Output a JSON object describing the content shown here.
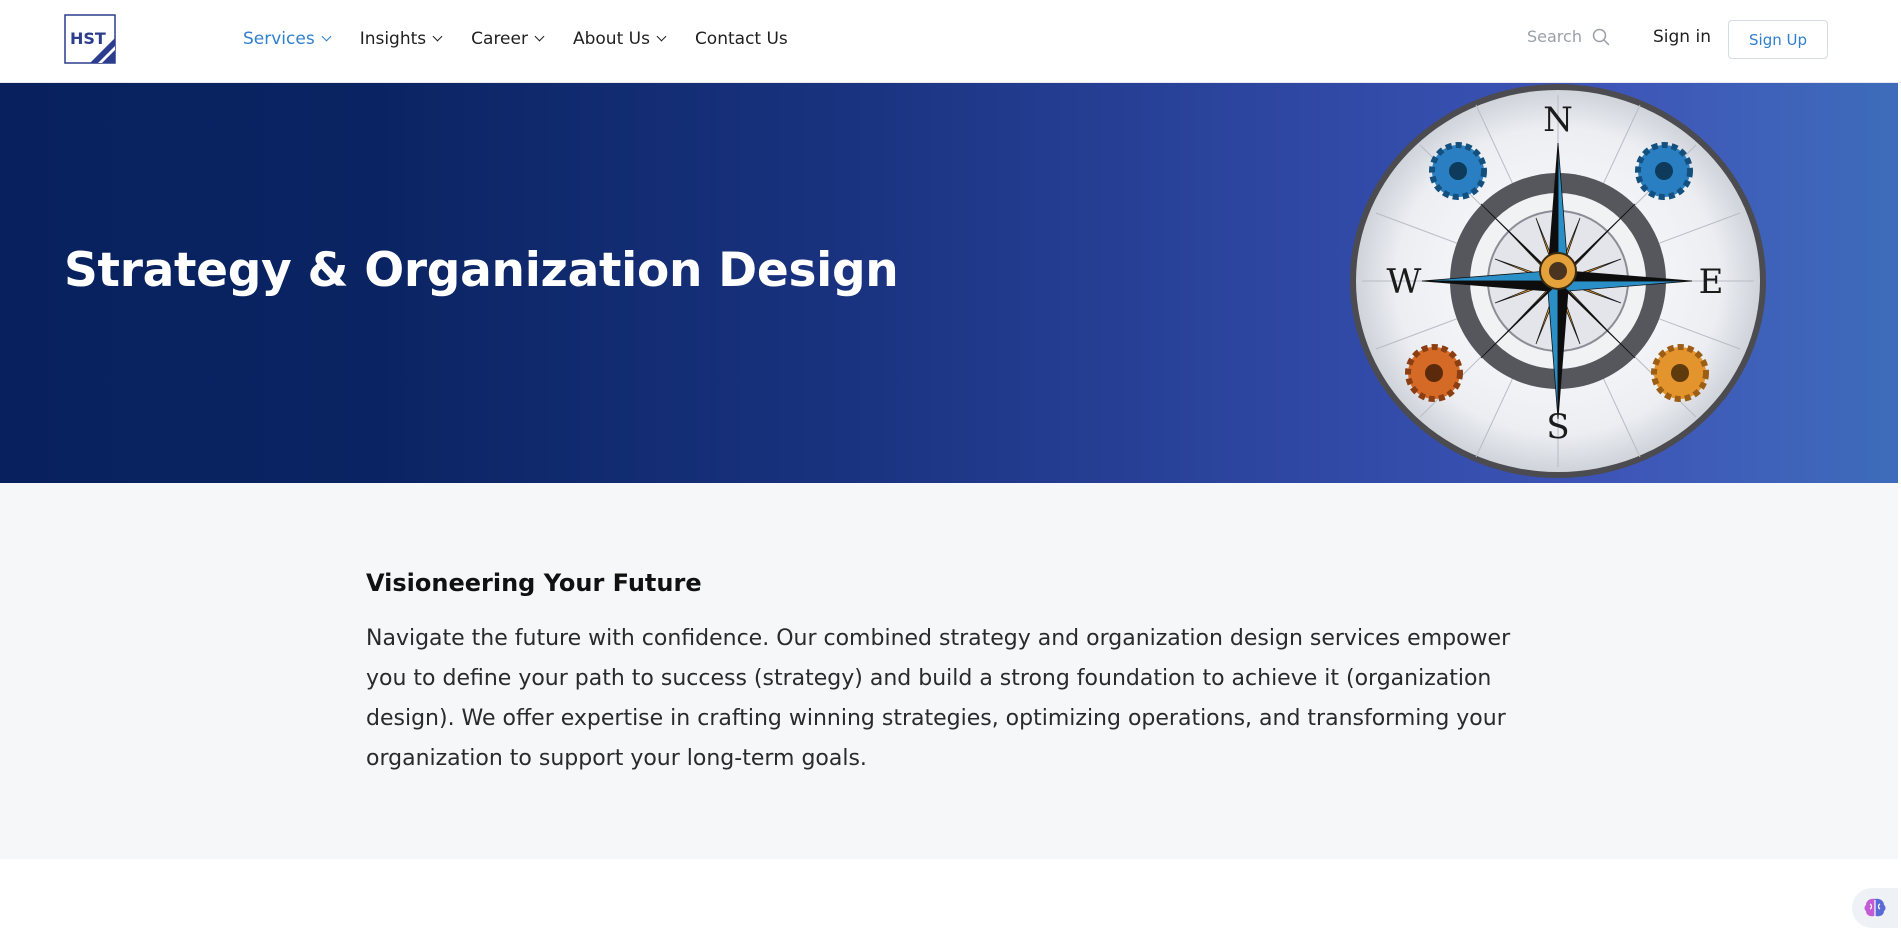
{
  "brand": {
    "logo_text": "HST"
  },
  "nav": {
    "items": [
      {
        "label": "Services",
        "has_dropdown": true,
        "active": true
      },
      {
        "label": "Insights",
        "has_dropdown": true,
        "active": false
      },
      {
        "label": "Career",
        "has_dropdown": true,
        "active": false
      },
      {
        "label": "About Us",
        "has_dropdown": true,
        "active": false
      },
      {
        "label": "Contact Us",
        "has_dropdown": false,
        "active": false
      }
    ],
    "search_placeholder": "Search",
    "signin_label": "Sign in",
    "signup_label": "Sign Up"
  },
  "hero": {
    "title": "Strategy & Organization Design",
    "image_icon": "compass-with-gears-icon",
    "compass_letters": {
      "n": "N",
      "s": "S",
      "e": "E",
      "w": "W"
    }
  },
  "intro": {
    "heading": "Visioneering Your Future",
    "body": "Navigate the future with confidence. Our combined strategy and organization design services empower you to define your path to success (strategy) and build a strong foundation to achieve it (organization design). We offer expertise in crafting winning strategies, optimizing operations, and transforming your organization to support your long-term goals."
  },
  "floating_widget": {
    "icon": "brain-icon"
  },
  "colors": {
    "accent": "#2f7fd0",
    "hero_dark": "#08215e",
    "hero_light": "#3e55b8",
    "section_bg": "#f6f7f9"
  }
}
